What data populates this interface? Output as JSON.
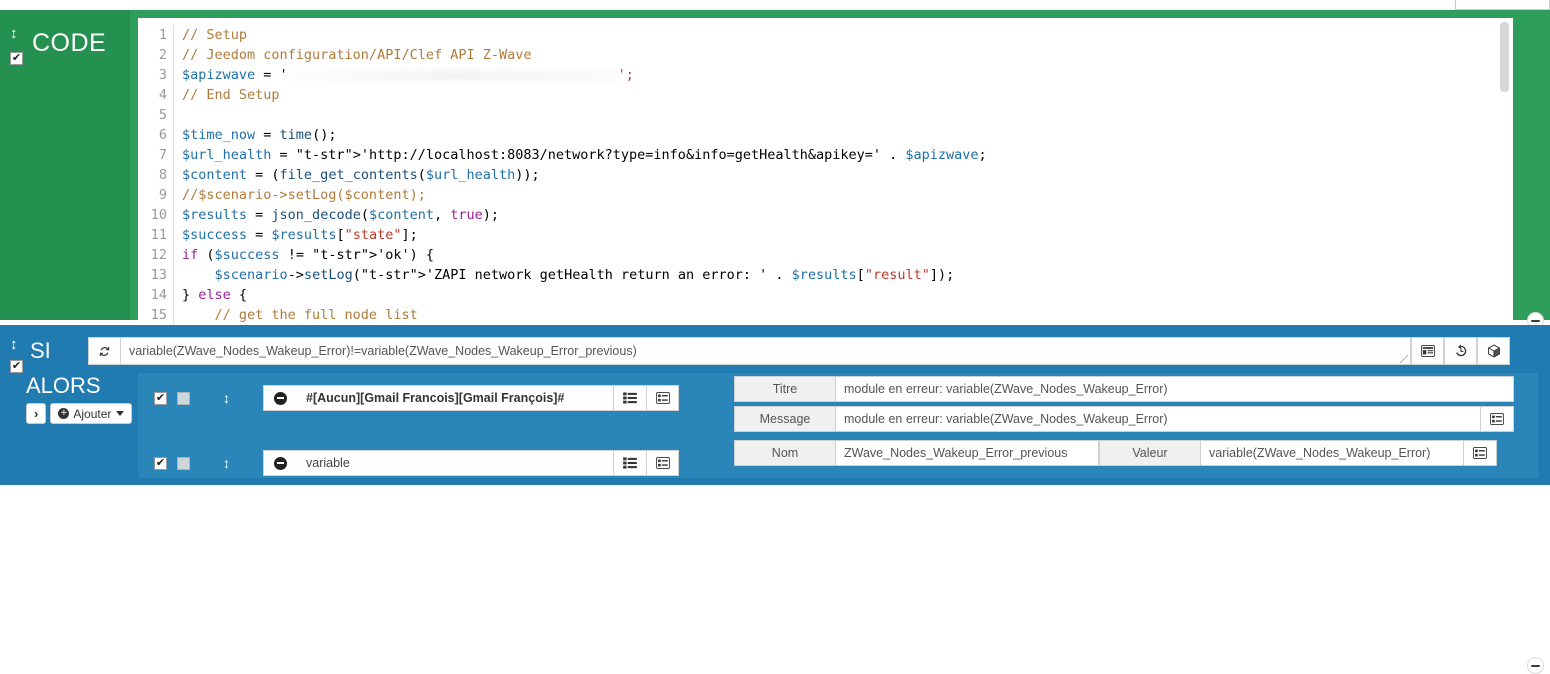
{
  "code_panel": {
    "title": "CODE",
    "checkbox_checked": true,
    "move_icon": "updown-arrow-icon",
    "lines": [
      {
        "n": "1",
        "type": "comment",
        "text": "// Setup"
      },
      {
        "n": "2",
        "type": "comment",
        "text": "// Jeedom configuration/API/Clef API Z-Wave"
      },
      {
        "n": "3",
        "type": "redacted",
        "text": "$apizwave = '",
        "suffix": "';"
      },
      {
        "n": "4",
        "type": "comment",
        "text": "// End Setup"
      },
      {
        "n": "5",
        "type": "blank",
        "text": ""
      },
      {
        "n": "6",
        "type": "code",
        "text": "$time_now = time();"
      },
      {
        "n": "7",
        "type": "code",
        "text": "$url_health = 'http://localhost:8083/network?type=info&info=getHealth&apikey=' . $apizwave;"
      },
      {
        "n": "8",
        "type": "code",
        "text": "$content = (file_get_contents($url_health));"
      },
      {
        "n": "9",
        "type": "comment",
        "text": "//$scenario->setLog($content);"
      },
      {
        "n": "10",
        "type": "code",
        "text": "$results = json_decode($content, true);"
      },
      {
        "n": "11",
        "type": "code",
        "text": "$success = $results[\"state\"];"
      },
      {
        "n": "12",
        "type": "code",
        "text": "if ($success != 'ok') {"
      },
      {
        "n": "13",
        "type": "code",
        "text": "    $scenario->setLog('ZAPI network getHealth return an error: ' . $results[\"result\"]);"
      },
      {
        "n": "14",
        "type": "code",
        "text": "} else {"
      },
      {
        "n": "15",
        "type": "comment",
        "text": "    // get the full node list"
      }
    ],
    "remove_button": "minus-circle-button"
  },
  "si_panel": {
    "title": "SI",
    "checkbox_checked": true,
    "refresh_icon": "refresh-icon",
    "condition": "variable(ZWave_Nodes_Wakeup_Error)!=variable(ZWave_Nodes_Wakeup_Error_previous)",
    "condition_placeholder": "",
    "tools": [
      {
        "name": "expression-list-icon",
        "glyph": "list-alt"
      },
      {
        "name": "history-icon",
        "glyph": "history"
      },
      {
        "name": "object-icon",
        "glyph": "cube"
      }
    ],
    "remove_button": "minus-circle-button"
  },
  "alors_panel": {
    "title": "ALORS",
    "expand_label": "›",
    "add_label": "Ajouter",
    "actions": [
      {
        "checkbox_checked": true,
        "enabled_square": false,
        "value": "#[Aucun][Gmail Francois][Gmail François]#",
        "icons": [
          "tasks-icon",
          "list-alt-icon"
        ],
        "params": [
          {
            "label": "Titre",
            "value": "module en erreur: variable(ZWave_Nodes_Wakeup_Error)",
            "icon": null
          },
          {
            "label": "Message",
            "value": "module en erreur: variable(ZWave_Nodes_Wakeup_Error)",
            "icon": "list-alt-icon"
          }
        ]
      },
      {
        "checkbox_checked": true,
        "enabled_square": false,
        "value": "variable",
        "icons": [
          "tasks-icon",
          "list-alt-icon"
        ],
        "params": [
          {
            "label": "Nom",
            "value": "ZWave_Nodes_Wakeup_Error_previous",
            "icon": null
          },
          {
            "label": "Valeur",
            "value": "variable(ZWave_Nodes_Wakeup_Error)",
            "icon": "list-alt-icon"
          }
        ]
      }
    ]
  },
  "colors": {
    "code_green": "#2e9e5b",
    "code_green_dark": "#259150",
    "si_blue": "#1f7bb0",
    "action_blue": "#2a86b8",
    "comment": "#b07b3a",
    "variable": "#1f6fa8",
    "string": "#c0392b",
    "keyword": "#9b1f9b"
  }
}
